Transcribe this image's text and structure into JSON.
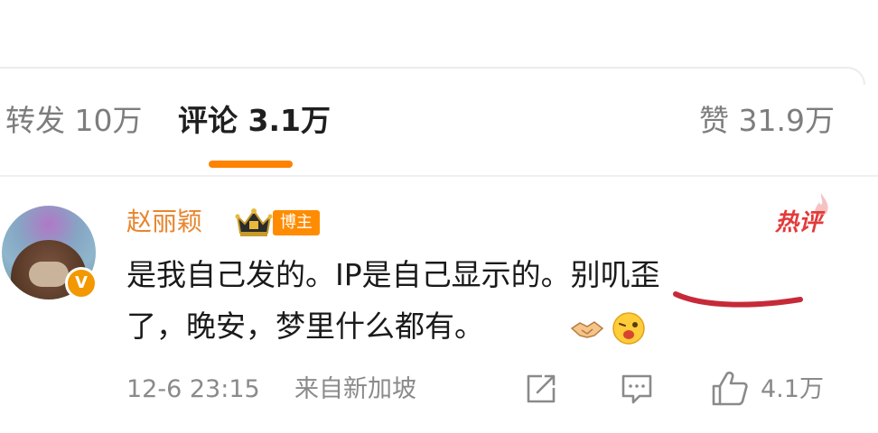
{
  "tabs": {
    "repost": "转发 10万",
    "comment": "评论 3.1万",
    "like": "赞 31.9万"
  },
  "comment": {
    "username": "赵丽颖",
    "role_badge": "博主",
    "vip_mark": "V",
    "hot_tag": "热评",
    "text_line1_a": "是我自己发的。IP是自己显示的。",
    "text_line1_b": "别叽歪",
    "text_line2": "了，晚安，梦里什么都有。",
    "time": "12-6 23:15",
    "location": "来自新加坡",
    "like_count": "4.1万"
  },
  "colors": {
    "accent": "#ff8200",
    "username": "#e8852e",
    "hot": "#e33a3a",
    "annotation": "#c62a38",
    "meta": "#8a8a8a"
  },
  "icons": [
    "crown-icon",
    "hot-flame-icon",
    "handshake-emoji",
    "wink-emoji",
    "share-icon",
    "reply-icon",
    "like-icon"
  ]
}
